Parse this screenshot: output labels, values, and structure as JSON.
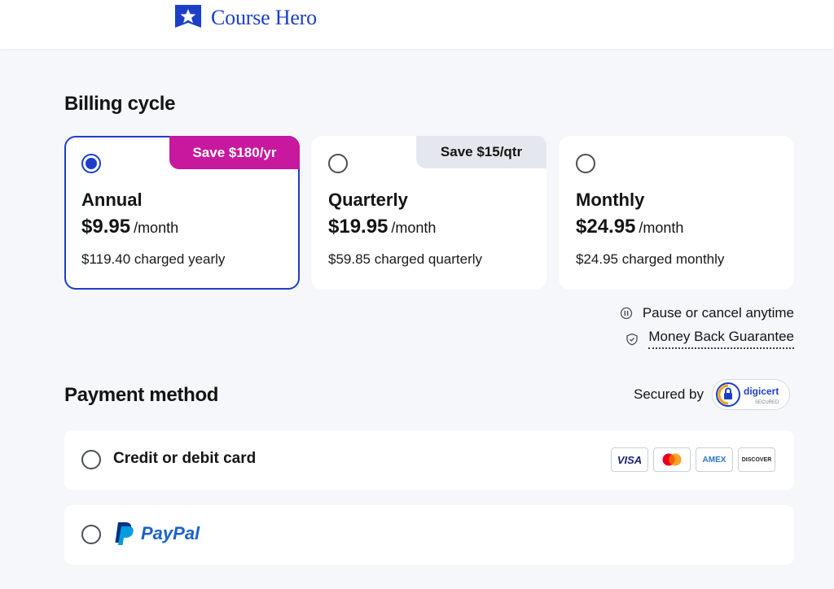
{
  "header": {
    "brand": "Course Hero"
  },
  "billing": {
    "title": "Billing cycle",
    "plans": [
      {
        "name": "Annual",
        "price": "$9.95",
        "per": "/month",
        "charge": "$119.40 charged yearly",
        "badge": "Save $180/yr",
        "selected": true
      },
      {
        "name": "Quarterly",
        "price": "$19.95",
        "per": "/month",
        "charge": "$59.85 charged quarterly",
        "badge": "Save $15/qtr",
        "selected": false
      },
      {
        "name": "Monthly",
        "price": "$24.95",
        "per": "/month",
        "charge": "$24.95 charged monthly",
        "badge": "",
        "selected": false
      }
    ],
    "perks": {
      "pause": "Pause or cancel anytime",
      "guarantee": "Money Back Guarantee"
    }
  },
  "payment": {
    "title": "Payment method",
    "secured_by": "Secured by",
    "digicert": {
      "name": "digicert",
      "sub": "SECURED"
    },
    "options": [
      {
        "label": "Credit or debit card"
      },
      {
        "label": "PayPal"
      }
    ],
    "card_brands": [
      "VISA",
      "mastercard",
      "AMEX",
      "DISCOVER"
    ]
  },
  "colors": {
    "accent": "#1d3fc7",
    "badge_pink": "#c8189d",
    "paypal_blue": "#1d62c7"
  }
}
